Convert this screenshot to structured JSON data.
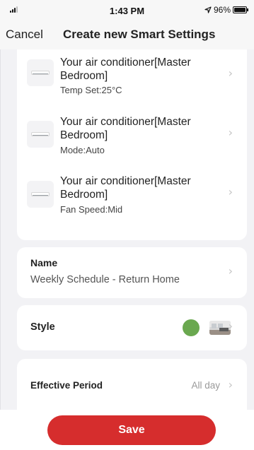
{
  "status_bar": {
    "time": "1:43 PM",
    "location_icon": "location-arrow-icon",
    "battery": "96%"
  },
  "nav": {
    "cancel_label": "Cancel",
    "title": "Create new Smart Settings"
  },
  "actions": [
    {
      "device": "Your air conditioner[Master Bedroom]",
      "detail": "Temp Set:25°C"
    },
    {
      "device": "Your air conditioner[Master Bedroom]",
      "detail": "Mode:Auto"
    },
    {
      "device": "Your air conditioner[Master Bedroom]",
      "detail": "Fan Speed:Mid"
    }
  ],
  "name_field": {
    "label": "Name",
    "value": "Weekly Schedule - Return Home"
  },
  "style_field": {
    "label": "Style",
    "color": "#6aa84f"
  },
  "period_field": {
    "label": "Effective Period",
    "value": "All day"
  },
  "save_label": "Save",
  "colors": {
    "accent": "#d62d2d",
    "background": "#f2f2f5"
  }
}
